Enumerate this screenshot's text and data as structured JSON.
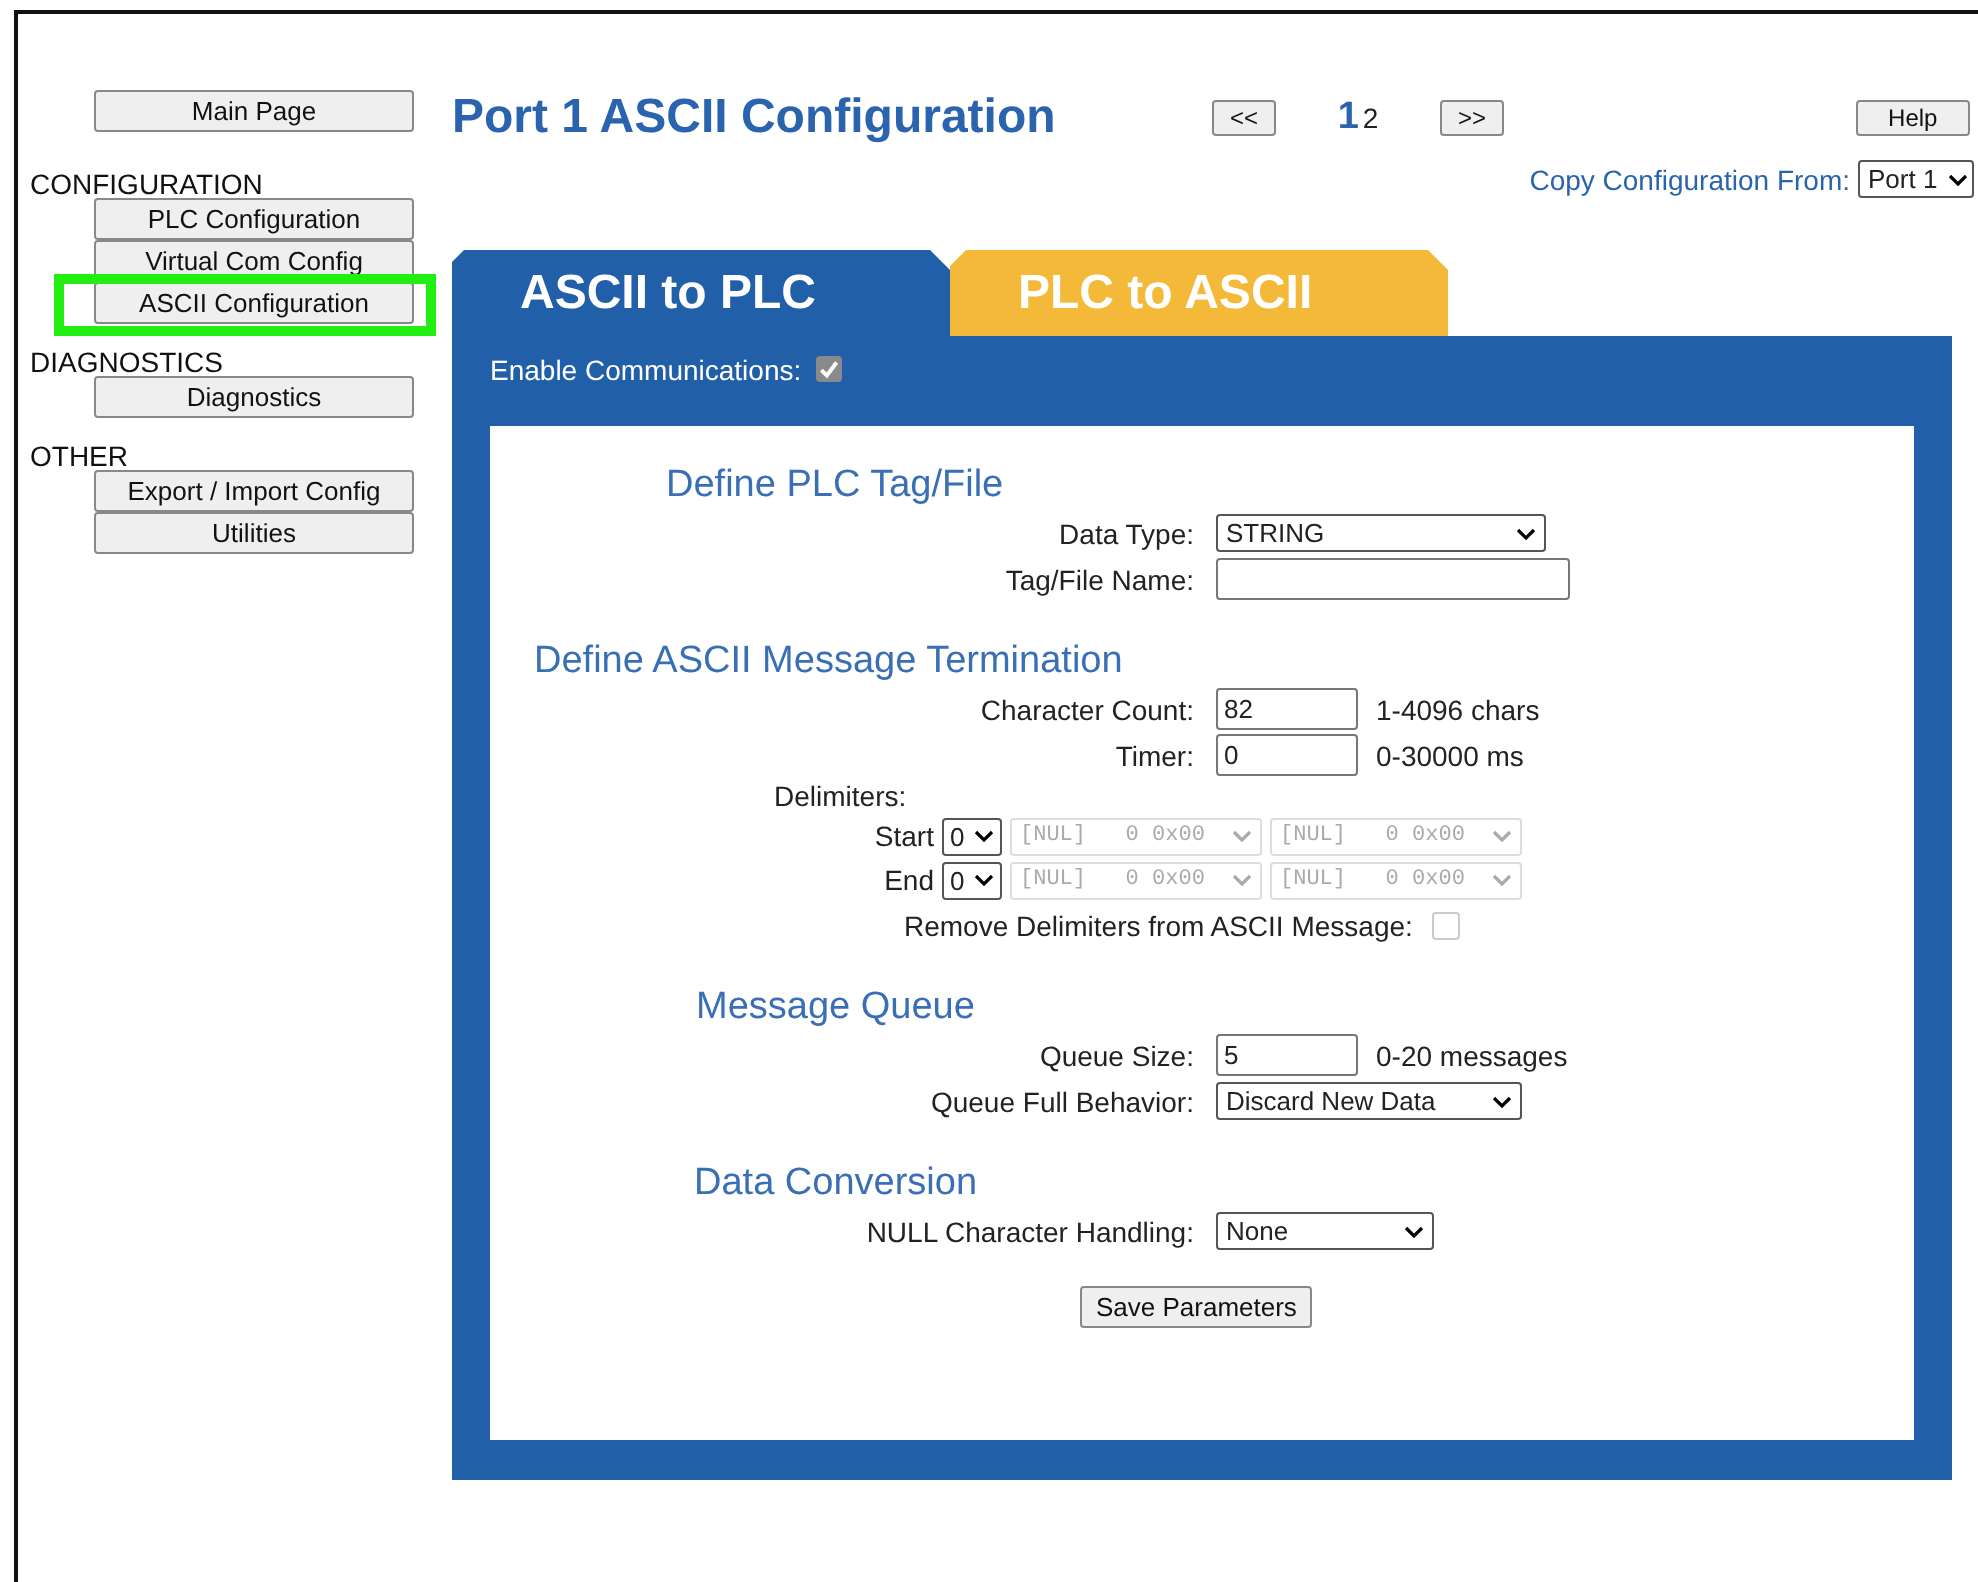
{
  "nav": {
    "top_button": {
      "label": "Main Page"
    },
    "sections": [
      {
        "heading": "CONFIGURATION",
        "items": [
          {
            "label": "PLC Configuration",
            "highlighted": false
          },
          {
            "label": "Virtual Com Config",
            "highlighted": false
          },
          {
            "label": "ASCII Configuration",
            "highlighted": true
          }
        ]
      },
      {
        "heading": "DIAGNOSTICS",
        "items": [
          {
            "label": "Diagnostics",
            "highlighted": false
          }
        ]
      },
      {
        "heading": "OTHER",
        "items": [
          {
            "label": "Export / Import Config",
            "highlighted": false
          },
          {
            "label": "Utilities",
            "highlighted": false
          }
        ]
      }
    ]
  },
  "header": {
    "title": "Port 1 ASCII Configuration",
    "prev": "<<",
    "pages": [
      {
        "label": "1",
        "selected": true
      },
      {
        "label": "2",
        "selected": false
      }
    ],
    "next": ">>",
    "help": "Help",
    "copy_from": {
      "label": "Copy Configuration From:",
      "value": "Port 1"
    }
  },
  "tabs": [
    {
      "label": "ASCII to PLC",
      "selected": true
    },
    {
      "label": "PLC to ASCII",
      "selected": false
    }
  ],
  "enable_communications": {
    "label": "Enable Communications:",
    "checked": true
  },
  "sections": [
    {
      "title": "Define PLC Tag/File",
      "fields": [
        {
          "kind": "select",
          "label": "Data Type:",
          "value": "STRING"
        },
        {
          "kind": "text",
          "label": "Tag/File Name:"
        }
      ]
    },
    {
      "title": "Define ASCII Message Termination",
      "fields": [
        {
          "kind": "text",
          "label": "Character Count:",
          "value": "82",
          "hint": "1-4096 chars"
        },
        {
          "kind": "text",
          "label": "Timer:",
          "value": "0",
          "hint": "0-30000 ms"
        },
        {
          "kind": "delimiters",
          "label": "Delimiters:",
          "rows": [
            {
              "label": "Start",
              "count": "0",
              "chars": [
                {
                  "value": "[NUL]   0 0x00",
                  "disabled": true
                },
                {
                  "value": "[NUL]   0 0x00",
                  "disabled": true
                }
              ]
            },
            {
              "label": "End",
              "count": "0",
              "chars": [
                {
                  "value": "[NUL]   0 0x00",
                  "disabled": true
                },
                {
                  "value": "[NUL]   0 0x00",
                  "disabled": true
                }
              ]
            }
          ]
        },
        {
          "kind": "checkbox",
          "label": "Remove Delimiters from ASCII Message:",
          "checked": false,
          "disabled": true
        }
      ]
    },
    {
      "title": "Message Queue",
      "fields": [
        {
          "kind": "text",
          "label": "Queue Size:",
          "value": "5",
          "hint": "0-20 messages"
        },
        {
          "kind": "select",
          "label": "Queue Full Behavior:",
          "value": "Discard New Data"
        }
      ]
    },
    {
      "title": "Data Conversion",
      "fields": [
        {
          "kind": "select",
          "label": "NULL Character Handling:",
          "value": "None"
        }
      ]
    }
  ],
  "save_button": {
    "label": "Save Parameters"
  }
}
